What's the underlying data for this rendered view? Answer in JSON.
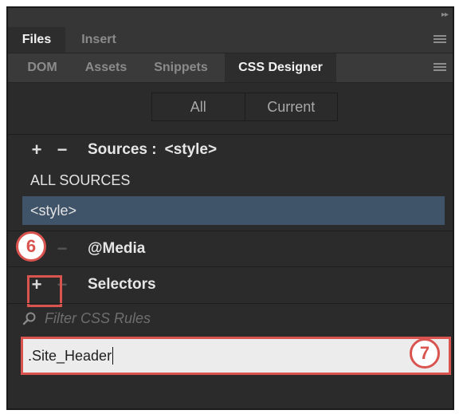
{
  "panel_tabs_top": [
    {
      "label": "Files",
      "active": true
    },
    {
      "label": "Insert",
      "active": false
    }
  ],
  "panel_tabs": [
    {
      "label": "DOM",
      "active": false
    },
    {
      "label": "Assets",
      "active": false
    },
    {
      "label": "Snippets",
      "active": false
    },
    {
      "label": "CSS Designer",
      "active": true
    }
  ],
  "view_toggle": {
    "all": "All",
    "current": "Current"
  },
  "sources": {
    "add": "+",
    "remove": "−",
    "title": "Sources :",
    "current": "<style>",
    "items": [
      "ALL SOURCES",
      "<style>"
    ],
    "selected_index": 1
  },
  "media": {
    "add": "+",
    "remove": "−",
    "title": "@Media"
  },
  "selectors": {
    "add": "+",
    "remove": "−",
    "title": "Selectors",
    "filter_placeholder": "Filter CSS Rules",
    "input_value": ".Site_Header"
  },
  "callouts": {
    "step6": "6",
    "step7": "7"
  },
  "colors": {
    "panel_bg": "#2b2b2b",
    "selection": "#3f5369",
    "callout_red": "#d9534f",
    "input_bg": "#ececec"
  },
  "icons": [
    "collapse-arrows-icon",
    "panel-menu-icon",
    "search-icon"
  ]
}
